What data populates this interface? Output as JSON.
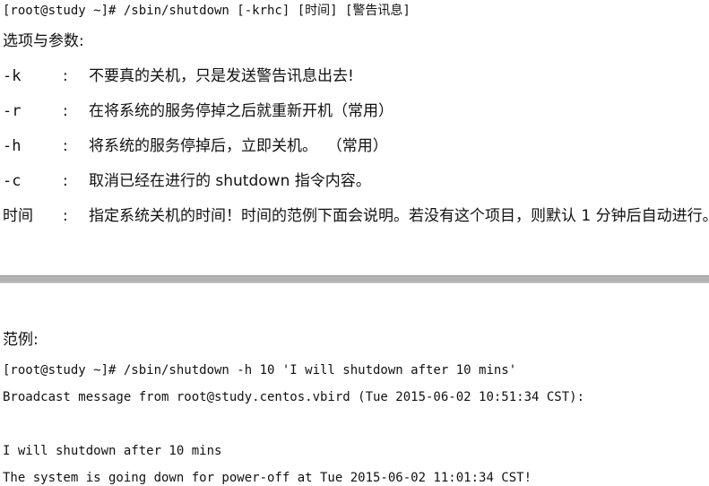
{
  "syntax": "[root@study ~]# /sbin/shutdown [-krhc] [时间] [警告讯息]",
  "options_heading": "选项与参数:",
  "options": [
    {
      "flag": "-k",
      "colon": ":",
      "desc": "不要真的关机，只是发送警告讯息出去!"
    },
    {
      "flag": "-r",
      "colon": ":",
      "desc": "在将系统的服务停掉之后就重新开机（常用）"
    },
    {
      "flag": "-h",
      "colon": ":",
      "desc": "将系统的服务停掉后，立即关机。  （常用）"
    },
    {
      "flag": "-c",
      "colon": ":",
      "desc": "取消已经在进行的 shutdown 指令内容。"
    },
    {
      "flag": "时间",
      "colon": ":",
      "desc": "指定系统关机的时间！时间的范例下面会说明。若没有这个项目，则默认 1 分钟后自动进行。"
    }
  ],
  "example_heading": "范例:",
  "example": {
    "command": "[root@study ~]# /sbin/shutdown -h 10 'I will shutdown after 10 mins'",
    "broadcast": "Broadcast message from root@study.centos.vbird (Tue 2015-06-02 10:51:34 CST):",
    "message": "I will shutdown after 10 mins",
    "status": "The system is going down for power-off at Tue 2015-06-02 11:01:34 CST!"
  }
}
